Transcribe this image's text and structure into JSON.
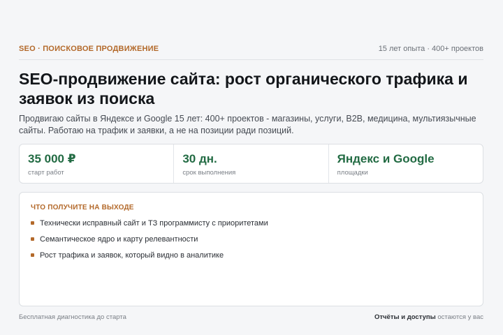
{
  "header": {
    "eyebrow": "SEO · ПОИСКОВОЕ ПРОДВИЖЕНИЕ",
    "meta": "15 лет опыта · 400+ проектов"
  },
  "hero": {
    "title": "SEO-продвижение сайта: рост органического трафика и заявок из поиска",
    "lead": "Продвигаю сайты в Яндексе и Google 15 лет: 400+ проектов - магазины, услуги, B2B, медицина, мультиязычные сайты. Работаю на трафик и заявки, а не на позиции ради позиций."
  },
  "stats": [
    {
      "value": "35 000 ₽",
      "label": "старт работ"
    },
    {
      "value": "30 дн.",
      "label": "срок выполнения"
    },
    {
      "value": "Яндекс и Google",
      "label": "площадки"
    }
  ],
  "deliverables": {
    "title": "ЧТО ПОЛУЧИТЕ НА ВЫХОДЕ",
    "items": [
      "Технически исправный сайт и ТЗ программисту с приоритетами",
      "Семантическое ядро и карту релевантности",
      "Рост трафика и заявок, который видно в аналитике"
    ]
  },
  "footer": {
    "left": "Бесплатная диагностика до старта",
    "right_bold": "Отчёты и доступы",
    "right_rest": " остаются у вас"
  },
  "colors": {
    "accent": "#b3692a",
    "value": "#226b43",
    "background": "#f5f6f8"
  }
}
